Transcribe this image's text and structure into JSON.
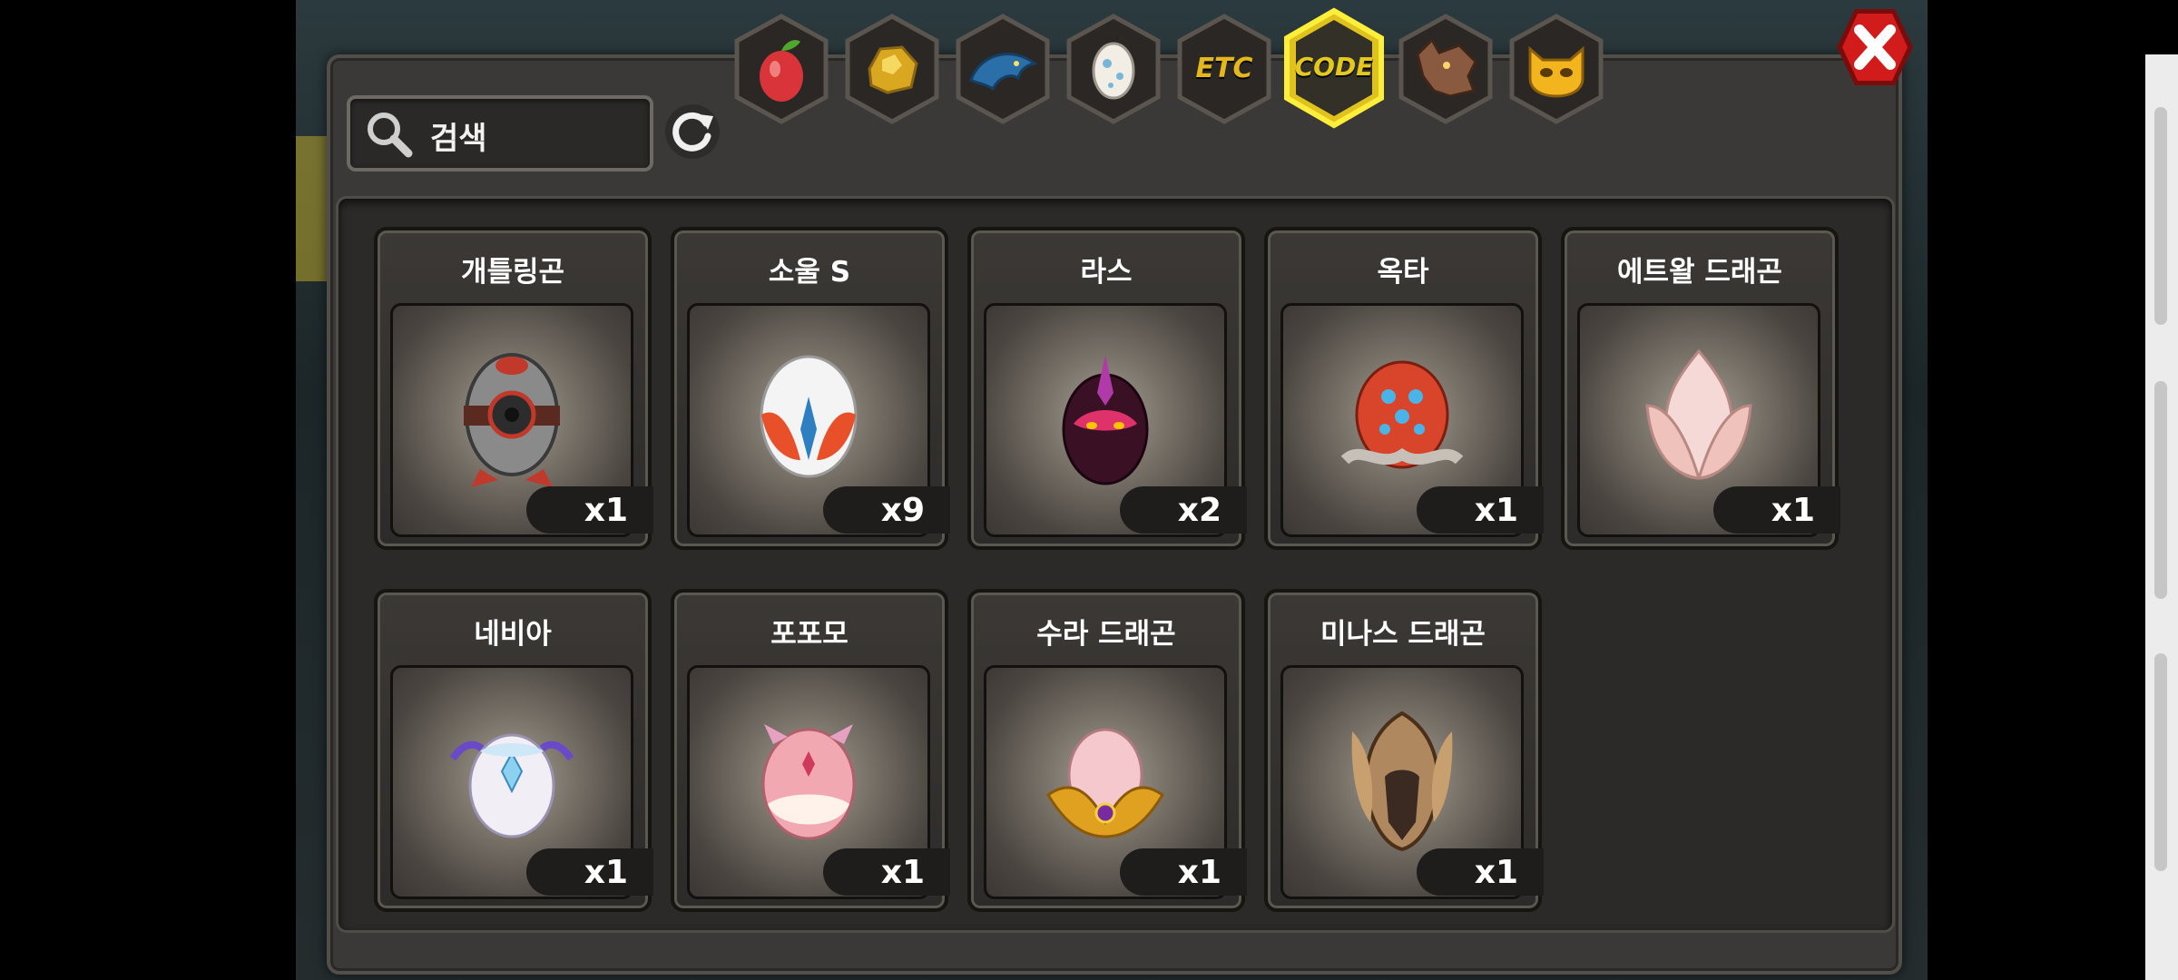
{
  "search": {
    "placeholder": "검색"
  },
  "tabs": [
    {
      "name": "fruit-tab",
      "label": ""
    },
    {
      "name": "gold-tab",
      "label": ""
    },
    {
      "name": "dragon-head-tab",
      "label": ""
    },
    {
      "name": "egg-tab",
      "label": ""
    },
    {
      "name": "etc-tab",
      "label": "ETC"
    },
    {
      "name": "code-tab",
      "label": "CODE"
    },
    {
      "name": "wolf-tab",
      "label": ""
    },
    {
      "name": "mask-tab",
      "label": ""
    }
  ],
  "active_tab": "CODE",
  "items": [
    {
      "name": "개틀링곤",
      "count": "x1"
    },
    {
      "name": "소울 S",
      "count": "x9"
    },
    {
      "name": "라스",
      "count": "x2"
    },
    {
      "name": "옥타",
      "count": "x1"
    },
    {
      "name": "에트왈 드래곤",
      "count": "x1"
    },
    {
      "name": "네비아",
      "count": "x1"
    },
    {
      "name": "포포모",
      "count": "x1"
    },
    {
      "name": "수라 드래곤",
      "count": "x1"
    },
    {
      "name": "미나스 드래곤",
      "count": "x1"
    }
  ]
}
